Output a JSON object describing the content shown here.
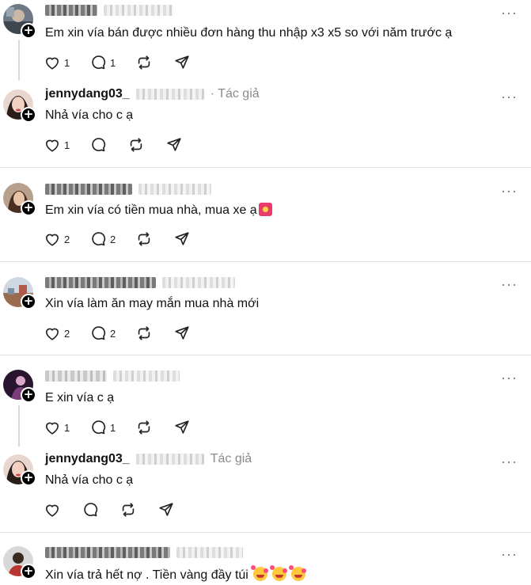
{
  "posts": [
    {
      "username": "",
      "author_tag": "",
      "text": "Em xin vía bán được nhiều đơn hàng thu nhập x3 x5 so với năm trước ạ",
      "likes": "1",
      "replies": "1",
      "emoji": "none",
      "faces": []
    },
    {
      "username": "jennydang03_",
      "author_tag": "· Tác giả",
      "text": "Nhả vía cho c ạ",
      "likes": "1",
      "replies": "",
      "emoji": "none",
      "faces": []
    },
    {
      "username": "",
      "author_tag": "",
      "text": "Em xin vía có tiền mua nhà, mua xe ạ",
      "likes": "2",
      "replies": "2",
      "emoji": "red-envelope",
      "faces": []
    },
    {
      "username": "",
      "author_tag": "",
      "text": "Xin vía làm ăn may mắn mua nhà mới",
      "likes": "2",
      "replies": "2",
      "emoji": "none",
      "faces": []
    },
    {
      "username": "",
      "author_tag": "",
      "text": "E xin vía c ạ",
      "likes": "1",
      "replies": "1",
      "emoji": "none",
      "faces": []
    },
    {
      "username": "jennydang03_",
      "author_tag": "Tác giả",
      "text": "Nhả vía cho c ạ",
      "likes": "",
      "replies": "",
      "emoji": "none",
      "faces": []
    },
    {
      "username": "",
      "author_tag": "",
      "text": "Xin vía trả hết nợ . Tiền vàng đầy túi",
      "likes": "",
      "replies": "",
      "emoji": "none",
      "faces": [
        "smiling-face-with-hearts",
        "smiling-face-with-hearts",
        "smiling-face-with-hearts"
      ]
    }
  ],
  "icons": {
    "like": "heart-icon",
    "reply": "comment-icon",
    "repost": "repost-icon",
    "share": "share-icon",
    "more": "more-icon",
    "follow": "plus-icon"
  },
  "more_label": "···",
  "follow_label": "+"
}
